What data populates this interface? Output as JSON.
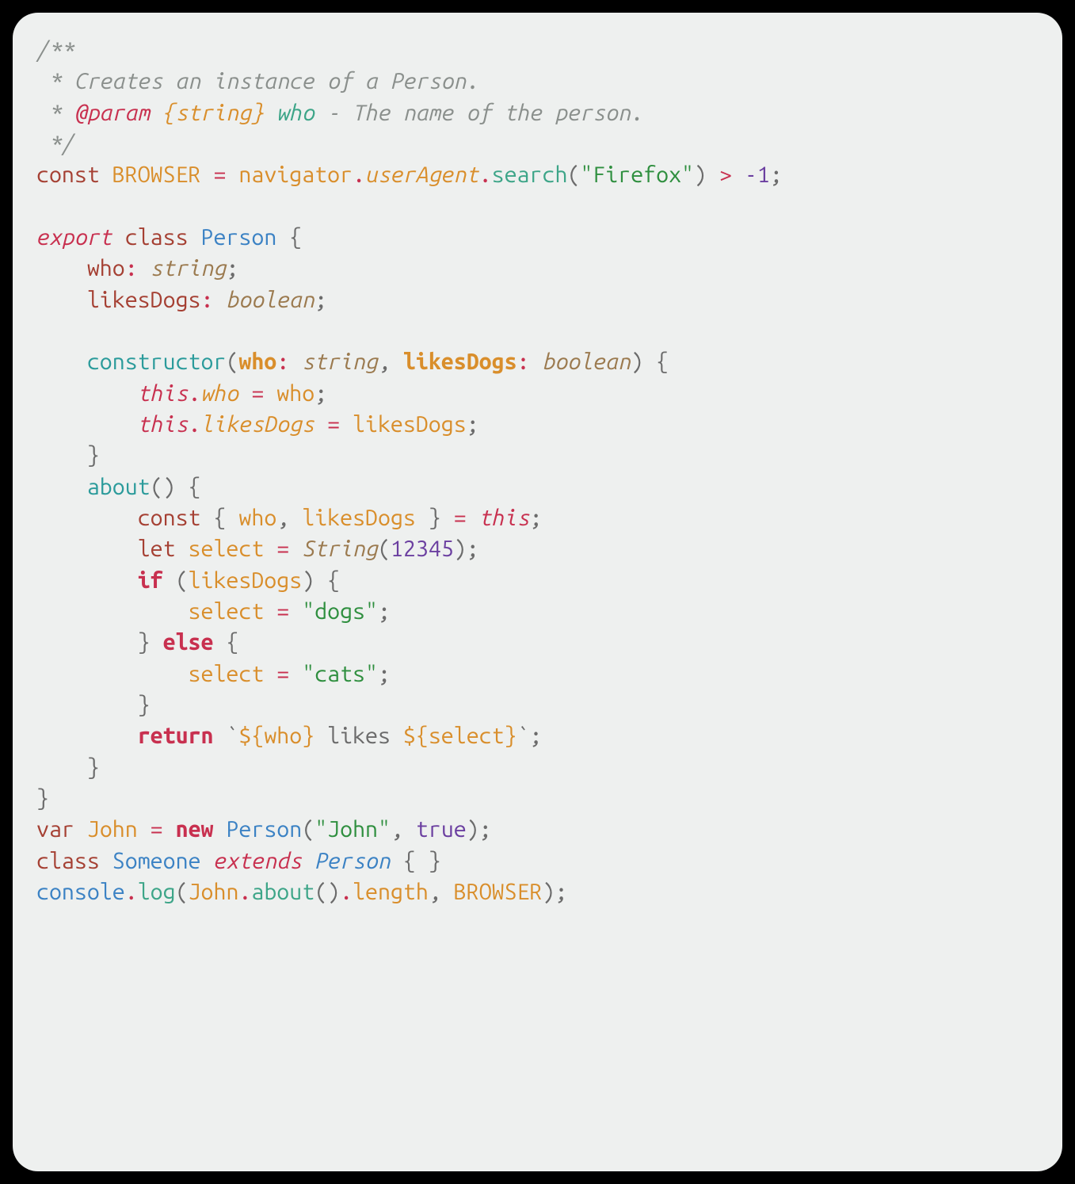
{
  "code": {
    "jsdoc": {
      "open": "/**",
      "desc": " * Creates an instance of a Person.",
      "param_line_prefix": " * ",
      "tag": "@param",
      "type": "{string}",
      "name": "who",
      "rest": " - The name of the person.",
      "close": " */"
    },
    "line_const_browser": {
      "kw": "const",
      "name": "BROWSER",
      "eq": "=",
      "navigator": "navigator",
      "dot1": ".",
      "userAgent": "userAgent",
      "dot2": ".",
      "search": "search",
      "lp": "(",
      "str": "\"Firefox\"",
      "rp": ")",
      "gt": ">",
      "neg1": "-1",
      "semi": ";"
    },
    "line_export_class": {
      "export": "export",
      "class": "class",
      "name": "Person",
      "brace": "{"
    },
    "field_who": {
      "name": "who",
      "colon": ":",
      "type": "string",
      "semi": ";"
    },
    "field_likes": {
      "name": "likesDogs",
      "colon": ":",
      "type": "boolean",
      "semi": ";"
    },
    "ctor": {
      "kw": "constructor",
      "lp": "(",
      "p1": "who",
      "c1": ":",
      "t1": "string",
      "comma": ",",
      "p2": "likesDogs",
      "c2": ":",
      "t2": "boolean",
      "rp": ")",
      "brace": "{"
    },
    "assign_who": {
      "this": "this",
      "dot": ".",
      "prop": "who",
      "eq": "=",
      "val": "who",
      "semi": ";"
    },
    "assign_likes": {
      "this": "this",
      "dot": ".",
      "prop": "likesDogs",
      "eq": "=",
      "val": "likesDogs",
      "semi": ";"
    },
    "close_ctor": "}",
    "about": {
      "name": "about",
      "lp": "(",
      "rp": ")",
      "brace": "{"
    },
    "destructure": {
      "kw": "const",
      "lb": "{",
      "a": "who",
      "comma": ",",
      "b": "likesDogs",
      "rb": "}",
      "eq": "=",
      "this": "this",
      "semi": ";"
    },
    "let_select": {
      "kw": "let",
      "name": "select",
      "eq": "=",
      "String": "String",
      "lp": "(",
      "num": "12345",
      "rp": ")",
      "semi": ";"
    },
    "if_line": {
      "if": "if",
      "lp": "(",
      "cond": "likesDogs",
      "rp": ")",
      "brace": "{"
    },
    "sel_dogs": {
      "name": "select",
      "eq": "=",
      "str": "\"dogs\"",
      "semi": ";"
    },
    "else_line": {
      "rb": "}",
      "else": "else",
      "lb": "{"
    },
    "sel_cats": {
      "name": "select",
      "eq": "=",
      "str": "\"cats\"",
      "semi": ";"
    },
    "close_if": "}",
    "return_line": {
      "kw": "return",
      "bt1": "`",
      "d1o": "${",
      "v1": "who",
      "d1c": "}",
      "mid": " likes ",
      "d2o": "${",
      "v2": "select",
      "d2c": "}",
      "bt2": "`",
      "semi": ";"
    },
    "close_about": "}",
    "close_class": "}",
    "var_john": {
      "kw": "var",
      "name": "John",
      "eq": "=",
      "new": "new",
      "cls": "Person",
      "lp": "(",
      "str": "\"John\"",
      "comma": ",",
      "bool": "true",
      "rp": ")",
      "semi": ";"
    },
    "class_someone": {
      "kw": "class",
      "name": "Someone",
      "extends": "extends",
      "base": "Person",
      "lb": "{",
      "rb": "}"
    },
    "console_line": {
      "console": "console",
      "dot1": ".",
      "log": "log",
      "lp": "(",
      "John": "John",
      "dot2": ".",
      "about": "about",
      "lp2": "(",
      "rp2": ")",
      "dot3": ".",
      "length": "length",
      "comma": ",",
      "BROWSER": "BROWSER",
      "rp": ")",
      "semi": ";"
    }
  }
}
